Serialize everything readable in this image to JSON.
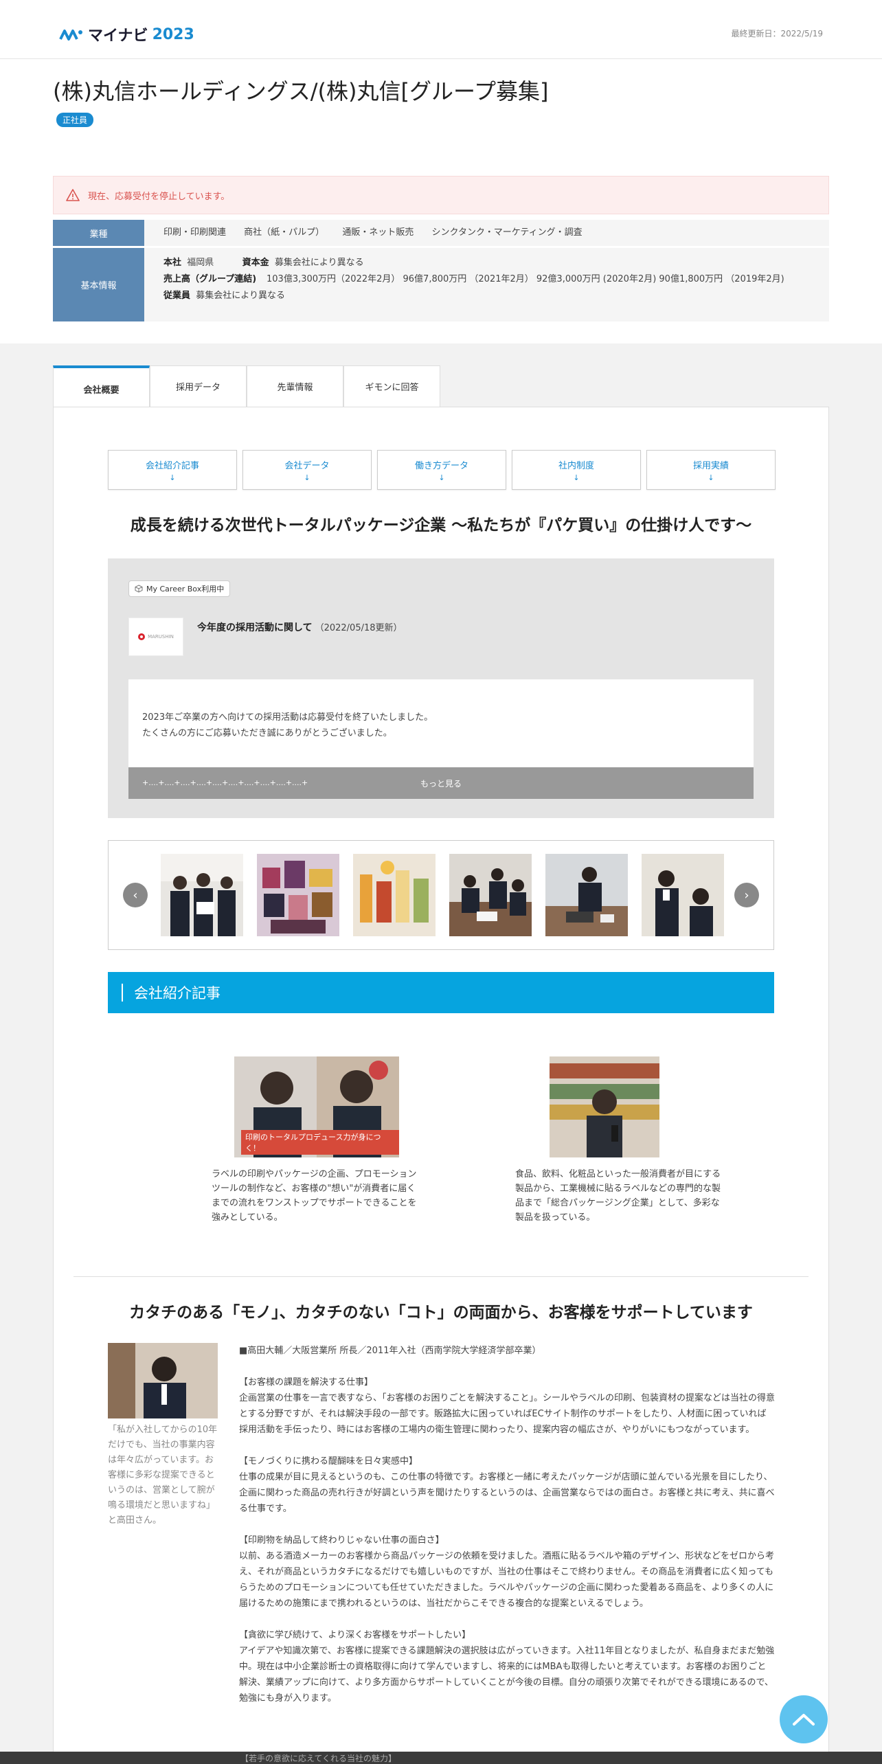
{
  "header": {
    "logo_text": "マイナビ",
    "logo_year": "2023",
    "updated": "最終更新日：2022/5/19"
  },
  "company": {
    "title": "(株)丸信ホールディングス/(株)丸信[グループ募集]",
    "employment_badge": "正社員"
  },
  "alert": {
    "text": "現在、応募受付を停止しています。"
  },
  "info": {
    "industry_label": "業種",
    "industries": [
      "印刷・印刷関連",
      "商社（紙・パルプ）",
      "通販・ネット販売",
      "シンクタンク・マーケティング・調査"
    ],
    "basic_label": "基本情報",
    "hq_key": "本社",
    "hq_value": "福岡県",
    "capital_key": "資本金",
    "capital_value": "募集会社により異なる",
    "sales_key": "売上高（グループ連結)",
    "sales_value": "103億3,300万円（2022年2月） 96億7,800万円 （2021年2月） 92億3,000万円 (2020年2月) 90億1,800万円 （2019年2月)",
    "employees_key": "従業員",
    "employees_value": "募集会社により異なる"
  },
  "tabs": [
    "会社概要",
    "採用データ",
    "先輩情報",
    "ギモンに回答"
  ],
  "subnav": [
    {
      "label": "会社紹介記事",
      "arrow": "↓"
    },
    {
      "label": "会社データ",
      "arrow": "↓"
    },
    {
      "label": "働き方データ",
      "arrow": "↓"
    },
    {
      "label": "社内制度",
      "arrow": "↓"
    },
    {
      "label": "採用実績",
      "arrow": "↓"
    }
  ],
  "catchcopy": "成長を続ける次世代トータルパッケージ企業 ～私たちが『パケ買い』の仕掛け人です～",
  "mycareerbox": {
    "badge": "My Career Box利用中",
    "logo_text": "MARUSHIN",
    "heading": "今年度の採用活動に関して",
    "date": "（2022/05/18更新）",
    "line1": "2023年ご卒業の方へ向けての採用活動は応募受付を終了いたしました。",
    "line2": "たくさんの方にご応募いただき誠にありがとうございました。",
    "dots": "+....+....+....+....+....+....+....+....+....+....+",
    "more": "もっと見る"
  },
  "carousel": {
    "prev": "‹",
    "next": "›"
  },
  "section_title": "会社紹介記事",
  "articles": [
    {
      "caption": "印刷のトータルプロデュース力が身につく！",
      "text": "ラベルの印刷やパッケージの企画、プロモーションツールの制作など、お客様の\"想い\"が消費者に届くまでの流れをワンストップでサポートできることを強みとしている。"
    },
    {
      "caption": "",
      "text": "食品、飲料、化粧品といった一般消費者が目にする製品から、工業機械に貼るラベルなどの専門的な製品まで「総合パッケージング企業」として、多彩な製品を扱っている。"
    }
  ],
  "catchcopy2": "カタチのある「モノ」、カタチのない「コト」の両面から、お客様をサポートしています",
  "interview": {
    "quote": "「私が入社してからの10年だけでも、当社の事業内容は年々広がっています。お客様に多彩な提案できるというのは、営業として腕が鳴る環境だと思いますね」と高田さん。",
    "paragraphs": [
      "■高田大輔／大阪営業所 所長／2011年入社（西南学院大学経済学部卒業）",
      "【お客様の課題を解決する仕事】\n企画営業の仕事を一言で表すなら、「お客様のお困りごとを解決すること」。シールやラベルの印刷、包装資材の提案などは当社の得意とする分野ですが、それは解決手段の一部です。販路拡大に困っていればECサイト制作のサポートをしたり、人材面に困っていれば採用活動を手伝ったり、時にはお客様の工場内の衛生管理に関わったり、提案内容の幅広さが、やりがいにもつながっています。",
      "【モノづくりに携わる醍醐味を日々実感中】\n仕事の成果が目に見えるというのも、この仕事の特徴です。お客様と一緒に考えたパッケージが店頭に並んでいる光景を目にしたり、企画に関わった商品の売れ行きが好調という声を聞けたりするというのは、企画営業ならではの面白さ。お客様と共に考え、共に喜べる仕事です。",
      "【印刷物を納品して終わりじゃない仕事の面白さ】\n以前、ある酒造メーカーのお客様から商品パッケージの依頼を受けました。酒瓶に貼るラベルや箱のデザイン、形状などをゼロから考え、それが商品というカタチになるだけでも嬉しいものですが、当社の仕事はそこで終わりません。その商品を消費者に広く知ってもらうためのプロモーションについても任せていただきました。ラベルやパッケージの企画に関わった愛着ある商品を、より多くの人に届けるための施策にまで携われるというのは、当社だからこそできる複合的な提案といえるでしょう。",
      "【貪欲に学び続けて、より深くお客様をサポートしたい】\nアイデアや知識次第で、お客様に提案できる課題解決の選択肢は広がっていきます。入社11年目となりましたが、私自身まだまだ勉強中。現在は中小企業診断士の資格取得に向けて学んでいますし、将来的にはMBAも取得したいと考えています。お客様のお困りごと解決、業績アップに向けて、より多方面からサポートしていくことが今後の目標。自分の頑張り次第でそれができる環境にあるので、勉強にも身が入ります。"
    ],
    "next_heading": "【若手の意欲に応えてくれる当社の魅力】"
  },
  "colors": {
    "accent": "#1a8bd0",
    "section": "#06a4df",
    "info_head": "#5b88b3",
    "alert": "#d9534f"
  }
}
